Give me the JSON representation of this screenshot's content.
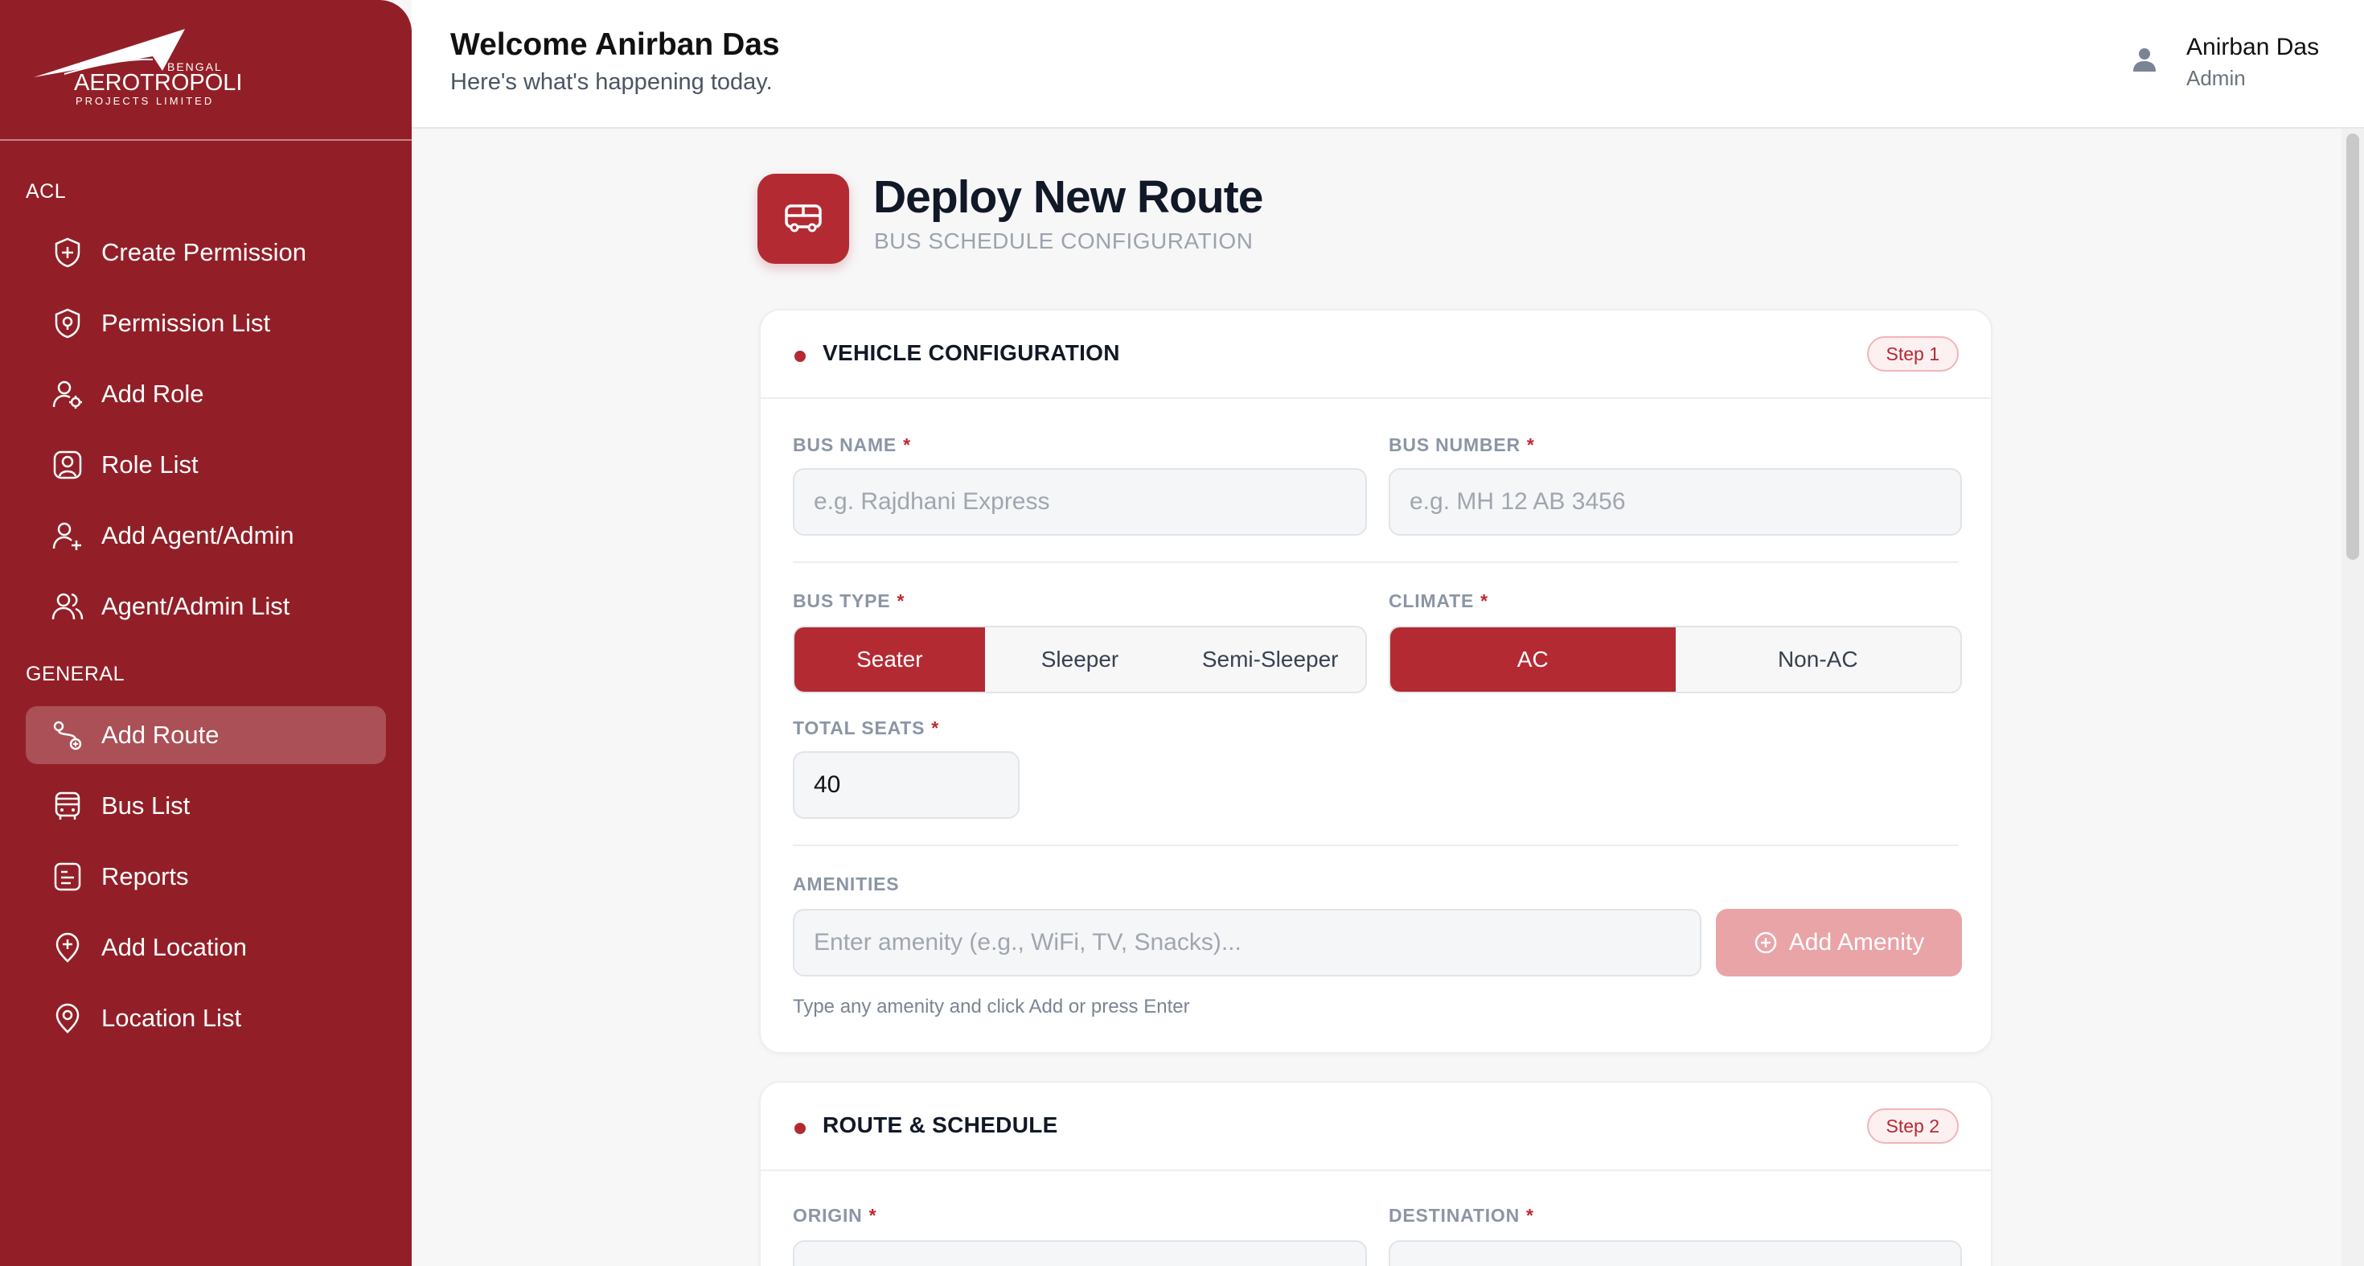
{
  "logo": {
    "line1": "BENGAL",
    "line2": "AEROTROPOLIS",
    "line3": "PROJECTS LIMITED"
  },
  "sidebar": {
    "acl_label": "ACL",
    "general_label": "GENERAL",
    "items": [
      {
        "label": "Create Permission",
        "icon": "shield-plus-icon"
      },
      {
        "label": "Permission List",
        "icon": "shield-pin-icon"
      },
      {
        "label": "Add Role",
        "icon": "user-gear-icon"
      },
      {
        "label": "Role List",
        "icon": "user-square-icon"
      },
      {
        "label": "Add Agent/Admin",
        "icon": "user-plus-icon"
      },
      {
        "label": "Agent/Admin List",
        "icon": "users-icon"
      },
      {
        "label": "Add Route",
        "icon": "route-icon",
        "active": true
      },
      {
        "label": "Bus List",
        "icon": "bus-icon"
      },
      {
        "label": "Reports",
        "icon": "report-icon"
      },
      {
        "label": "Add Location",
        "icon": "location-plus-icon"
      },
      {
        "label": "Location List",
        "icon": "location-pin-icon"
      }
    ]
  },
  "header": {
    "welcome": "Welcome Anirban Das",
    "subtitle": "Here's what's happening today.",
    "user_name": "Anirban Das",
    "user_role": "Admin"
  },
  "page": {
    "title": "Deploy New Route",
    "subtitle": "BUS SCHEDULE CONFIGURATION"
  },
  "vehicle": {
    "title": "VEHICLE CONFIGURATION",
    "step": "Step 1",
    "bus_name_label": "BUS NAME",
    "bus_name_placeholder": "e.g. Rajdhani Express",
    "bus_number_label": "BUS NUMBER",
    "bus_number_placeholder": "e.g. MH 12 AB 3456",
    "bus_type_label": "BUS TYPE",
    "bus_types": [
      "Seater",
      "Sleeper",
      "Semi-Sleeper"
    ],
    "bus_type_selected": "Seater",
    "climate_label": "CLIMATE",
    "climates": [
      "AC",
      "Non-AC"
    ],
    "climate_selected": "AC",
    "total_seats_label": "TOTAL SEATS",
    "total_seats_value": "40",
    "amenities_label": "AMENITIES",
    "amenity_placeholder": "Enter amenity (e.g., WiFi, TV, Snacks)...",
    "add_amenity_label": "Add Amenity",
    "amenity_hint": "Type any amenity and click Add or press Enter"
  },
  "route": {
    "title": "ROUTE & SCHEDULE",
    "step": "Step 2",
    "origin_label": "ORIGIN",
    "destination_label": "DESTINATION"
  },
  "req_mark": "*",
  "colors": {
    "brand": "#921f27",
    "accent": "#b42a33"
  }
}
